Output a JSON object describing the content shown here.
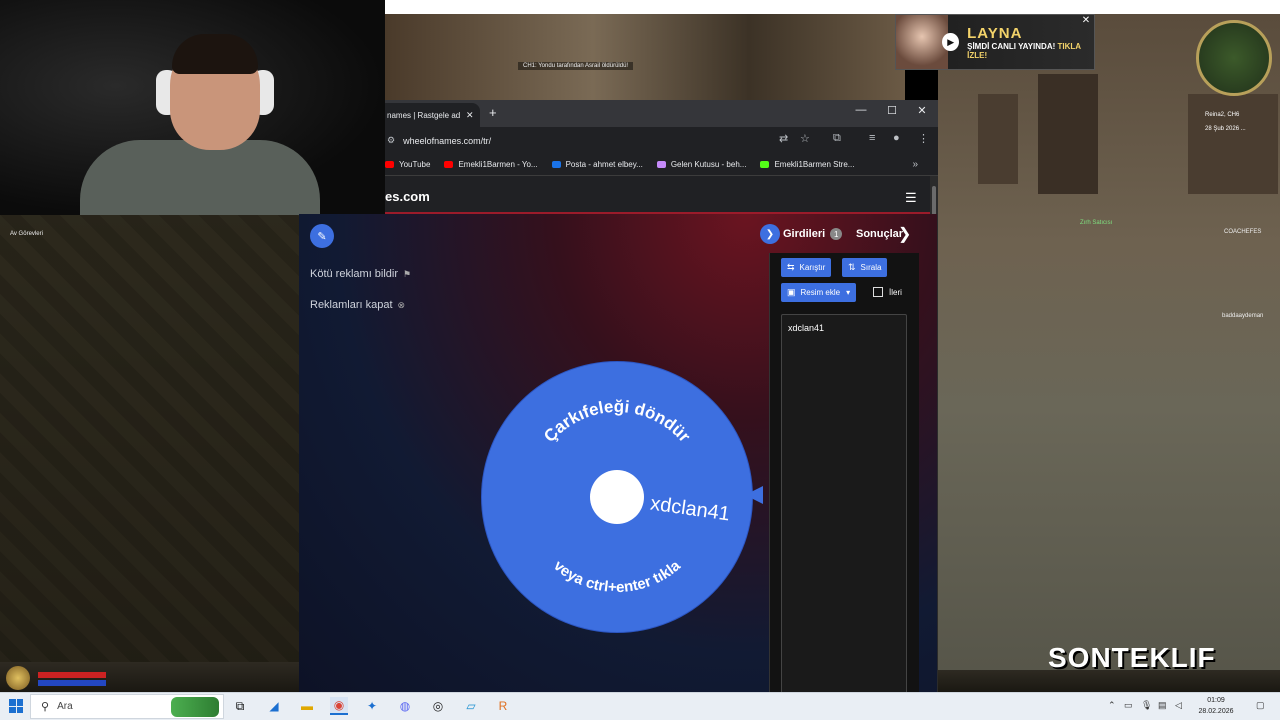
{
  "stream": {
    "ad_name": "LAYNA",
    "ad_line_a": "ŞİMDİ CANLI YAYINDA!",
    "ad_line_b": "TIKLA İZLE!",
    "kill_message": "CH1: Yondu tarafından Asrail öldürüldü!",
    "logo": "SONTEKLIF"
  },
  "game": {
    "left_label": "Av Görevleri",
    "npc_label": "Zırh Satıcısı",
    "map_label_1": "Reina2, CH6",
    "map_label_2": "28 Şub 2026 ...",
    "side_labels": [
      "COACHEFES",
      "baddaaydeman"
    ]
  },
  "browser": {
    "tab_title": "names | Rastgele ad",
    "url": "wheelofnames.com/tr/",
    "bookmarks": [
      {
        "label": "YouTube",
        "color": "#ff0000"
      },
      {
        "label": "Emekli1Barmen - Yo...",
        "color": "#ff0000"
      },
      {
        "label": "Posta - ahmet elbey...",
        "color": "#1a73e8"
      },
      {
        "label": "Gelen Kutusu - beh...",
        "color": "#c58af9"
      },
      {
        "label": "Emekli1Barmen Stre...",
        "color": "#53fc18"
      }
    ]
  },
  "site": {
    "brand": "es.com",
    "report_ad": "Kötü reklamı bildir",
    "close_ads": "Reklamları kapat",
    "tab_entries": "Girdileri",
    "entries_count": "1",
    "tab_results": "Sonuçlar",
    "shuffle": "Karıştır",
    "sort": "Sırala",
    "add_image": "Resim ekle",
    "advanced": "İleri",
    "entries": [
      "xdclan41"
    ]
  },
  "wheel": {
    "top_text": "Çarkıfeleği döndür",
    "bottom_text": "veya ctrl+enter tıkla",
    "segment_label": "xdclan41",
    "color": "#3d6fe0"
  },
  "taskbar": {
    "search_placeholder": "Ara",
    "time": "01:09",
    "date": "28.02.2026"
  }
}
